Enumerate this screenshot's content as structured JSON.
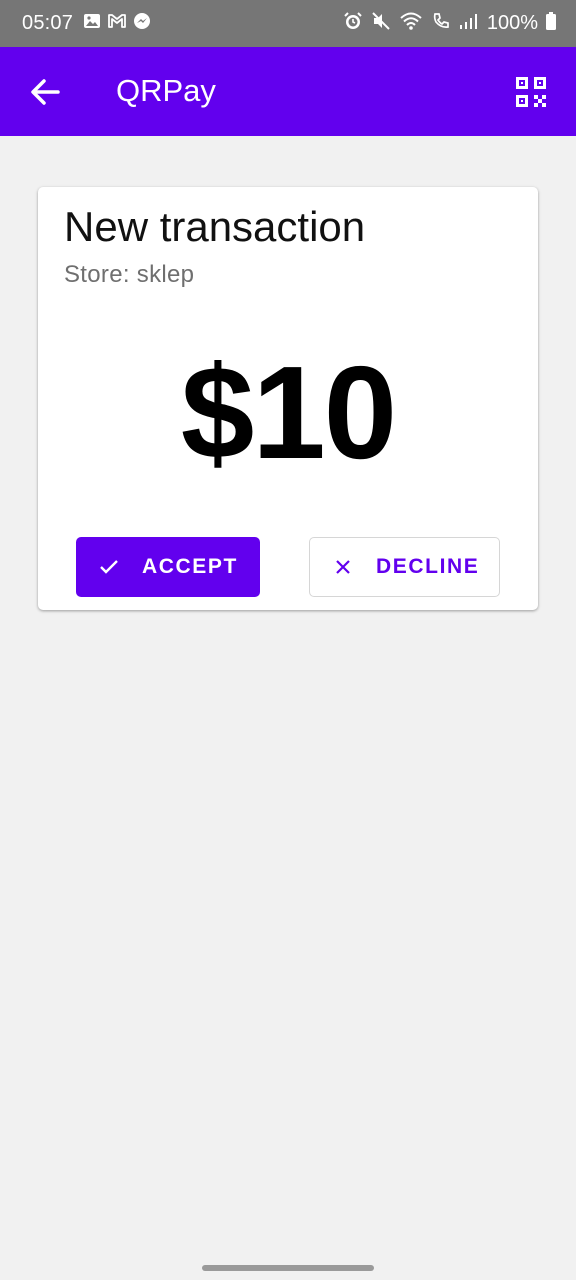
{
  "status_bar": {
    "time": "05:07",
    "battery": "100%",
    "icons": [
      "gallery-icon",
      "gmail-icon",
      "messenger-icon",
      "alarm-icon",
      "mute-icon",
      "wifi-icon",
      "call-icon",
      "signal-icon",
      "battery-icon"
    ]
  },
  "app_bar": {
    "title": "QRPay",
    "background": "#6200ee",
    "back_icon": "arrow-back-icon",
    "action_icon": "qr-code-icon"
  },
  "transaction": {
    "title": "New transaction",
    "store": "Store: sklep",
    "amount": "$10"
  },
  "actions": {
    "accept_label": "ACCEPT",
    "accept_icon": "check-icon",
    "decline_label": "DECLINE",
    "decline_icon": "close-icon"
  },
  "colors": {
    "accent": "#6200ee",
    "background": "#f1f1f1"
  }
}
